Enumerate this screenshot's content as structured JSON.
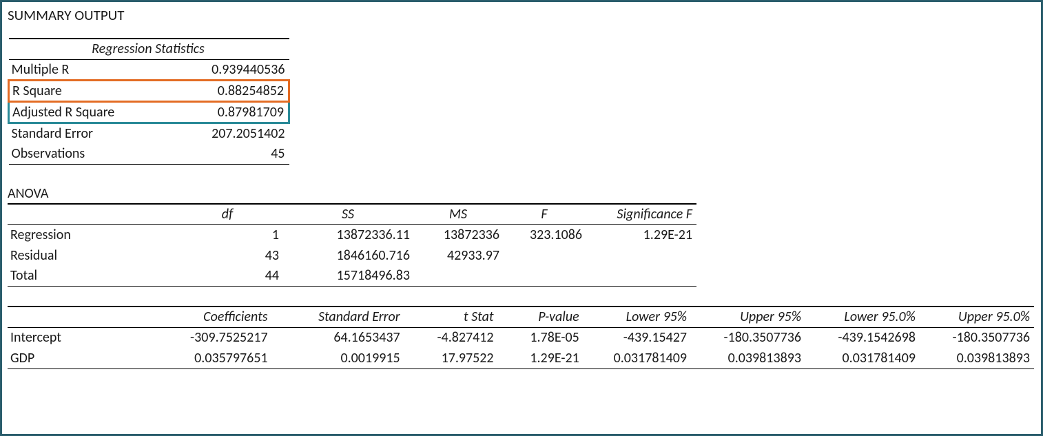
{
  "title": "SUMMARY OUTPUT",
  "regression_statistics": {
    "header": "Regression Statistics",
    "rows": [
      {
        "label": "Multiple R",
        "value": "0.939440536"
      },
      {
        "label": "R Square",
        "value": "0.88254852"
      },
      {
        "label": "Adjusted R Square",
        "value": "0.87981709"
      },
      {
        "label": "Standard Error",
        "value": "207.2051402"
      },
      {
        "label": "Observations",
        "value": "45"
      }
    ]
  },
  "anova": {
    "title": "ANOVA",
    "headers": {
      "df": "df",
      "ss": "SS",
      "ms": "MS",
      "f": "F",
      "sigf": "Significance F"
    },
    "rows": [
      {
        "label": "Regression",
        "df": "1",
        "ss": "13872336.11",
        "ms": "13872336",
        "f": "323.1086",
        "sigf": "1.29E-21"
      },
      {
        "label": "Residual",
        "df": "43",
        "ss": "1846160.716",
        "ms": "42933.97",
        "f": "",
        "sigf": ""
      },
      {
        "label": "Total",
        "df": "44",
        "ss": "15718496.83",
        "ms": "",
        "f": "",
        "sigf": ""
      }
    ]
  },
  "coefficients": {
    "headers": {
      "coef": "Coefficients",
      "se": "Standard Error",
      "tstat": "t Stat",
      "pval": "P-value",
      "l95": "Lower 95%",
      "u95": "Upper 95%",
      "l950": "Lower 95.0%",
      "u950": "Upper 95.0%"
    },
    "rows": [
      {
        "label": "Intercept",
        "coef": "-309.7525217",
        "se": "64.1653437",
        "tstat": "-4.827412",
        "pval": "1.78E-05",
        "l95": "-439.15427",
        "u95": "-180.3507736",
        "l950": "-439.1542698",
        "u950": "-180.3507736"
      },
      {
        "label": "GDP",
        "coef": "0.035797651",
        "se": "0.0019915",
        "tstat": "17.97522",
        "pval": "1.29E-21",
        "l95": "0.031781409",
        "u95": "0.039813893",
        "l950": "0.031781409",
        "u950": "0.039813893"
      }
    ]
  }
}
